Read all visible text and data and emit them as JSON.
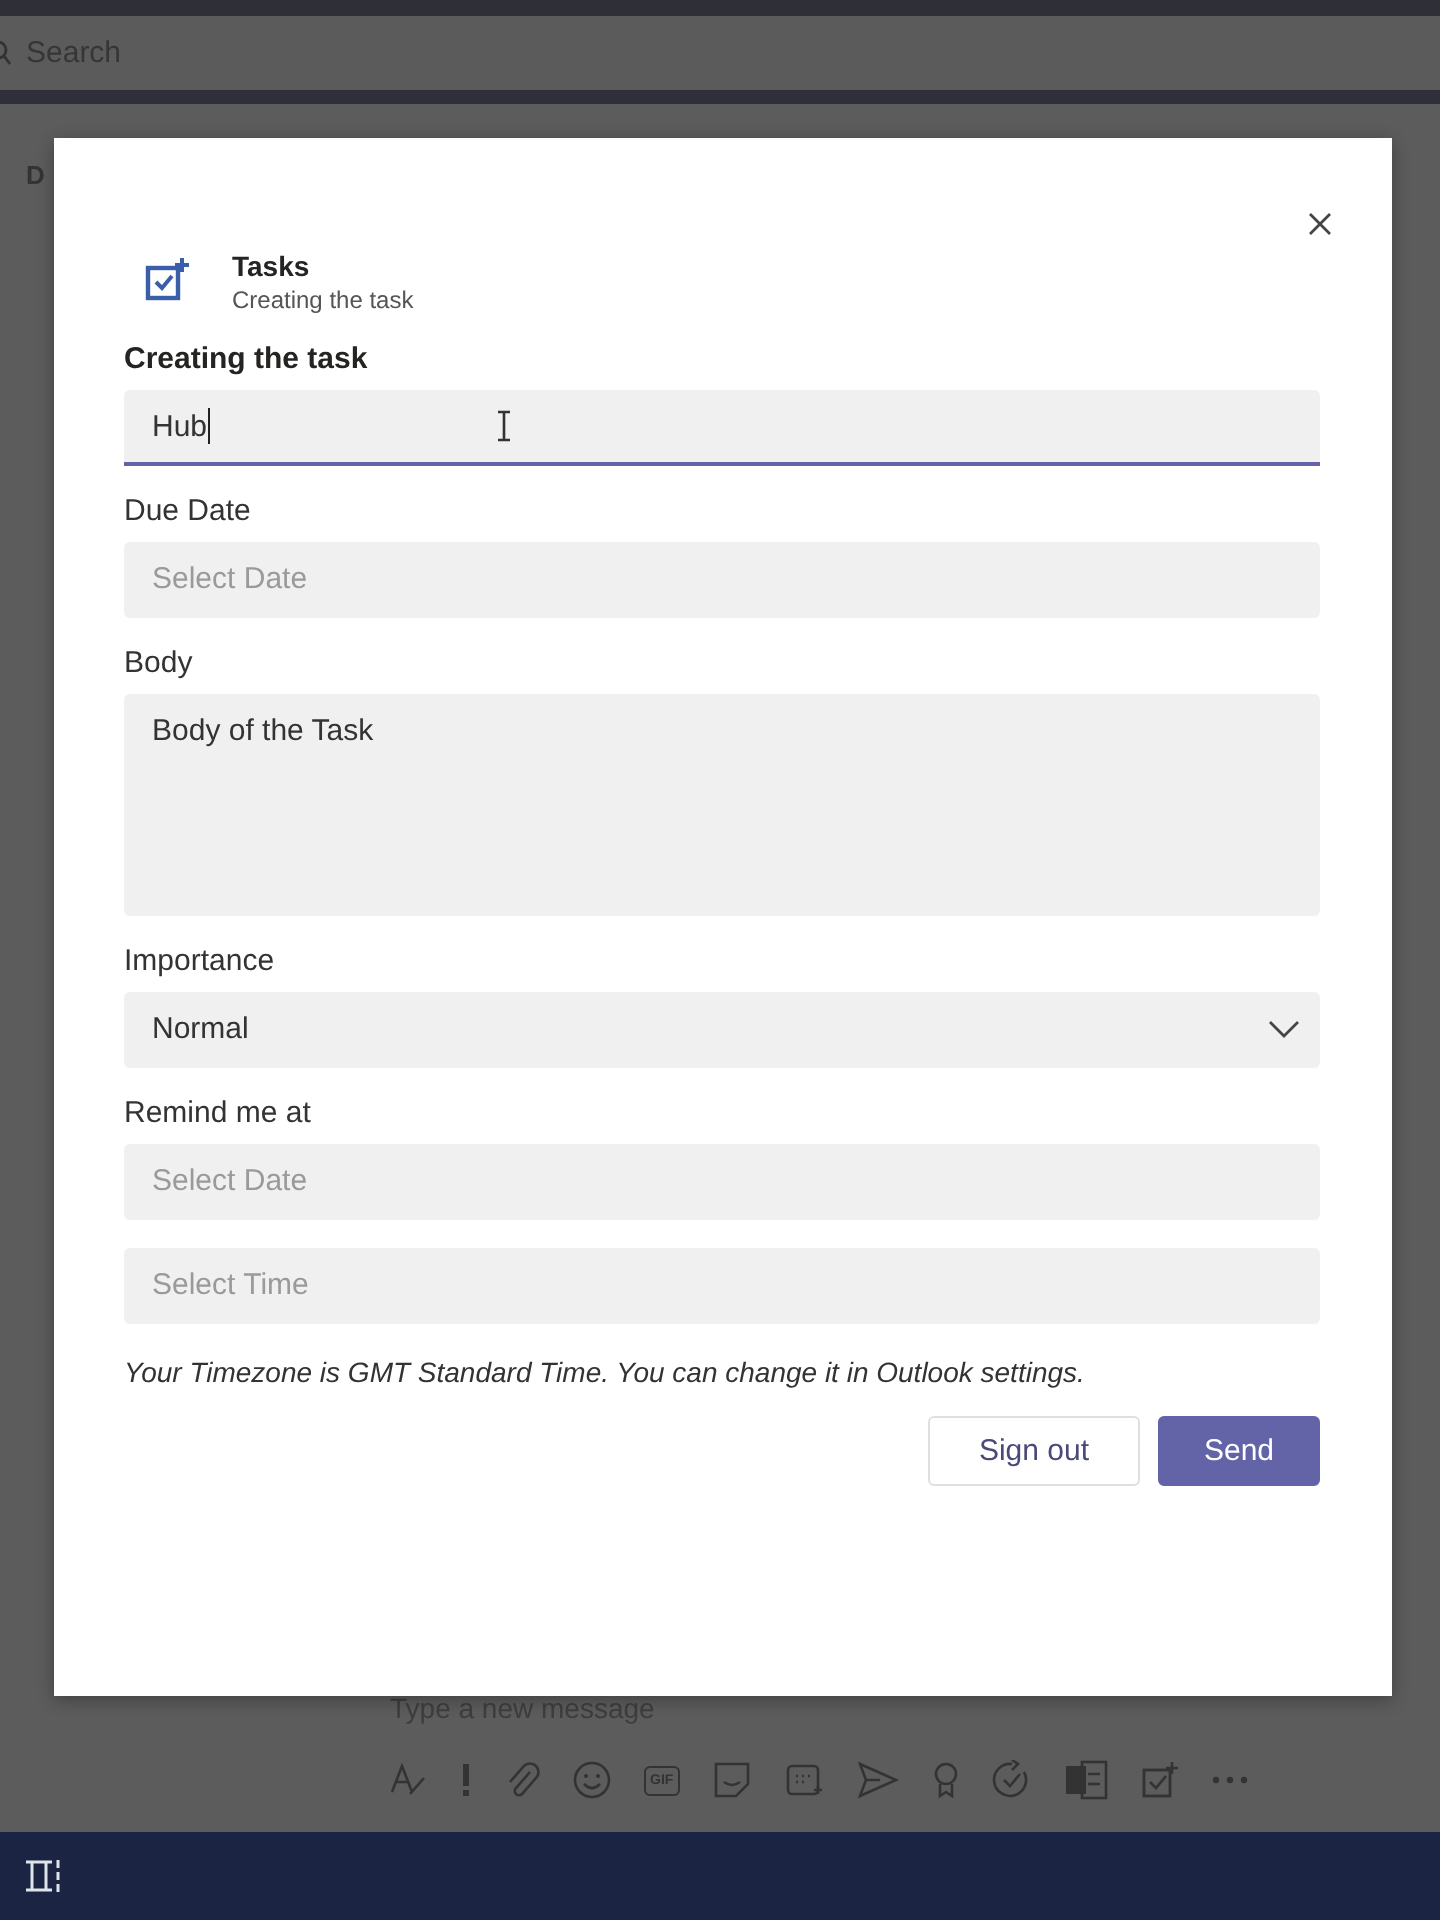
{
  "app_background": {
    "search_placeholder": "Search",
    "chat_initials": "D",
    "composer_placeholder": "Type a new message",
    "gif_label": "GIF"
  },
  "dialog": {
    "app_name": "Tasks",
    "app_subtitle": "Creating the task",
    "fields": [
      {
        "label": "Creating the task",
        "kind": "text",
        "value": "Hub",
        "focused": true
      },
      {
        "label": "Due Date",
        "kind": "date",
        "placeholder": "Select Date",
        "focused": false
      },
      {
        "label": "Body",
        "kind": "textarea",
        "value": "Body of the Task",
        "focused": false
      },
      {
        "label": "Importance",
        "kind": "select",
        "value": "Normal",
        "focused": false
      },
      {
        "label": "Remind me at",
        "kind": "date",
        "placeholder": "Select Date",
        "focused": false
      },
      {
        "kind": "time",
        "placeholder": "Select Time",
        "focused": false
      }
    ],
    "note": "Your Timezone is GMT Standard Time. You can change it in Outlook settings.",
    "buttons": [
      {
        "label": "Sign out",
        "kind": "secondary"
      },
      {
        "label": "Send",
        "kind": "primary"
      }
    ]
  }
}
